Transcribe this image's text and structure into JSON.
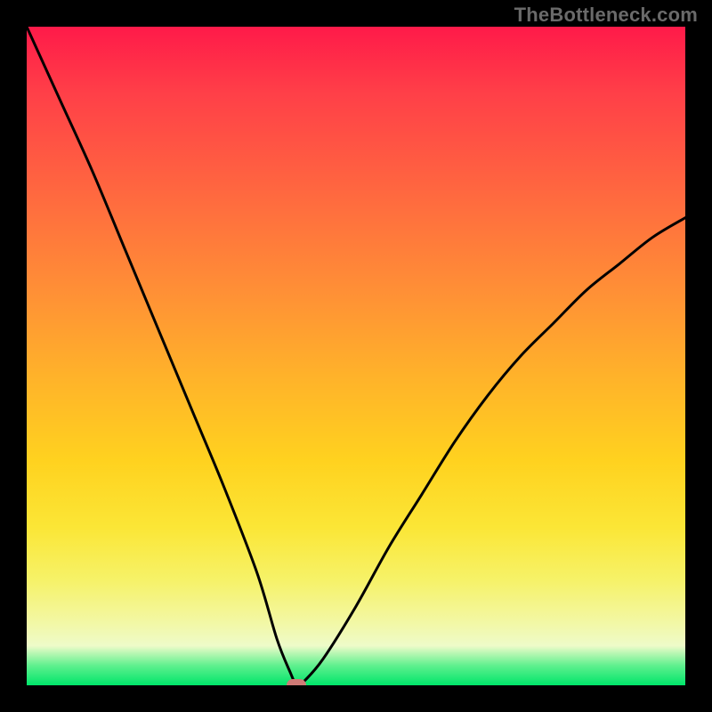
{
  "watermark": "TheBottleneck.com",
  "colors": {
    "background": "#000000",
    "gradient_stops": [
      "#ff1a49",
      "#ff6a3f",
      "#ffd21f",
      "#f3f7a0",
      "#00e56a"
    ],
    "curve_stroke": "#000000",
    "marker_fill": "#cf7a76"
  },
  "chart_data": {
    "type": "line",
    "title": "",
    "xlabel": "",
    "ylabel": "",
    "xlim": [
      0,
      100
    ],
    "ylim": [
      0,
      100
    ],
    "series": [
      {
        "name": "bottleneck-curve",
        "x": [
          0,
          5,
          10,
          15,
          20,
          25,
          30,
          35,
          38,
          40,
          41,
          42,
          45,
          50,
          55,
          60,
          65,
          70,
          75,
          80,
          85,
          90,
          95,
          100
        ],
        "y": [
          100,
          89,
          78,
          66,
          54,
          42,
          30,
          17,
          7,
          2,
          0,
          0.5,
          4,
          12,
          21,
          29,
          37,
          44,
          50,
          55,
          60,
          64,
          68,
          71
        ]
      }
    ],
    "annotations": [
      {
        "name": "minimum-marker",
        "x": 41,
        "y": 0
      }
    ]
  }
}
